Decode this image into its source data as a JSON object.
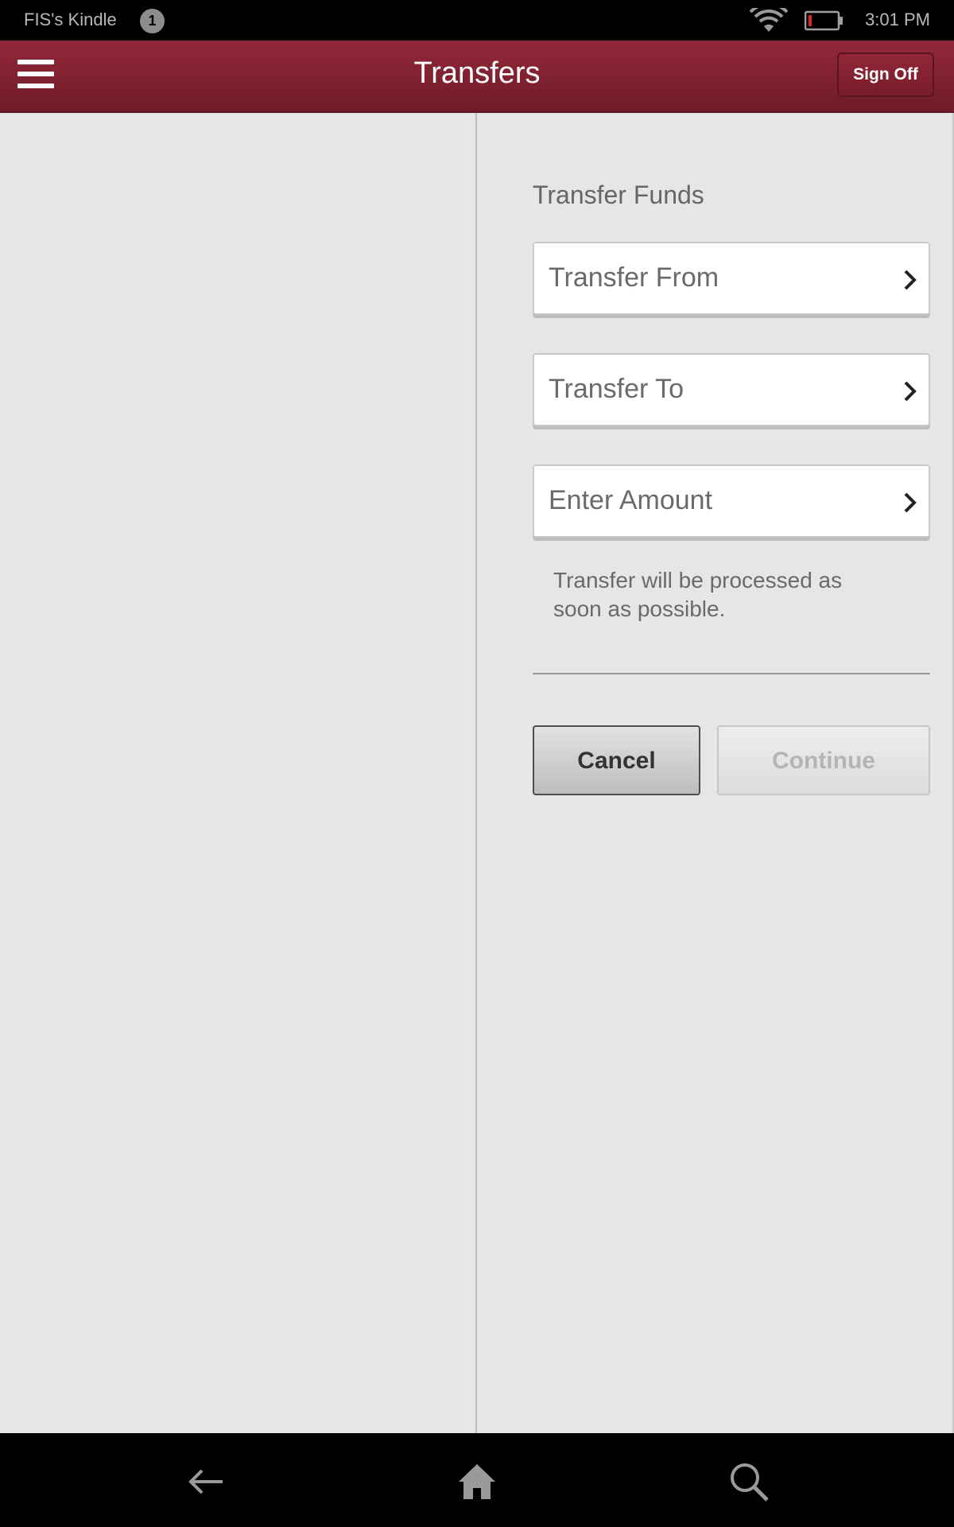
{
  "status_bar": {
    "device_name": "FIS's Kindle",
    "notification_count": "1",
    "time": "3:01 PM",
    "icons": [
      "wifi-icon",
      "battery-low-icon"
    ],
    "battery_color": "#e0222b"
  },
  "header": {
    "title": "Transfers",
    "menu_icon": "hamburger-menu-icon",
    "sign_off_label": "Sign Off",
    "color": "#8a2433"
  },
  "form": {
    "section_title": "Transfer Funds",
    "fields": [
      {
        "label": "Transfer From",
        "icon": "chevron-right-icon"
      },
      {
        "label": "Transfer To",
        "icon": "chevron-right-icon"
      },
      {
        "label": "Enter Amount",
        "icon": "chevron-right-icon"
      }
    ],
    "note": "Transfer will be processed as soon as possible.",
    "cancel_label": "Cancel",
    "continue_label": "Continue"
  },
  "nav_bar": {
    "icons": [
      "back-arrow-icon",
      "home-icon",
      "search-icon"
    ]
  }
}
